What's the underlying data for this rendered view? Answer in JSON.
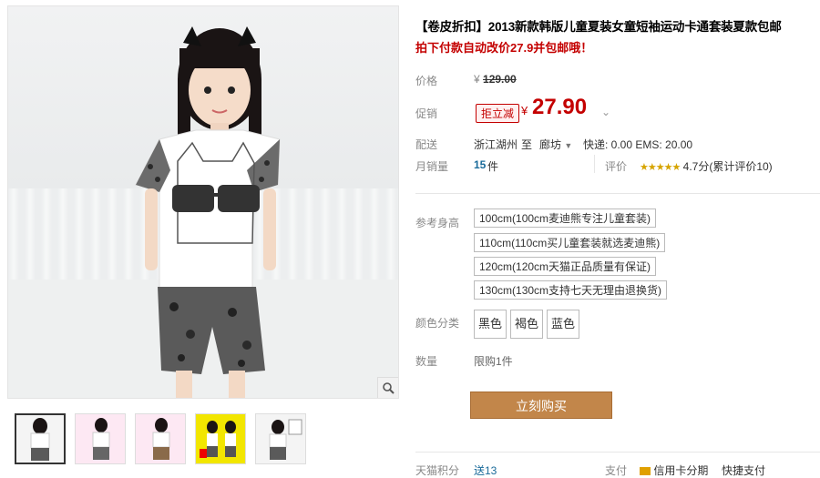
{
  "product": {
    "title": "【卷皮折扣】2013新款韩版儿童夏装女童短袖运动卡通套装夏款包邮",
    "promo_text": "拍下付款自动改价27.9并包邮哦！"
  },
  "pricing": {
    "orig_label": "价格",
    "orig_currency": "¥",
    "orig_price": "129.00",
    "promo_label": "促销",
    "promo_tag": "拒立减",
    "promo_currency": "¥",
    "promo_price": "27.90"
  },
  "shipping": {
    "label": "配送",
    "from": "浙江湖州",
    "to_word": "至",
    "dest": "廊坊",
    "fee": "快递: 0.00 EMS: 20.00"
  },
  "sales": {
    "label": "月销量",
    "count": "15",
    "unit": "件",
    "rating_label": "评价",
    "stars": "★★★★★",
    "rating": "4.7分(累计评价10)"
  },
  "size": {
    "label": "参考身高",
    "options": [
      "100cm(100cm麦迪熊专注儿童套装)",
      "110cm(110cm买儿童套装就选麦迪熊)",
      "120cm(120cm天猫正品质量有保证)",
      "130cm(130cm支持七天无理由退换货)"
    ]
  },
  "color": {
    "label": "颜色分类",
    "options": [
      "黑色",
      "褐色",
      "蓝色"
    ]
  },
  "quantity": {
    "label": "数量",
    "value": "限购1件"
  },
  "buy_button": "立刻购买",
  "footer": {
    "points_label": "天猫积分",
    "points_value": "送13",
    "pay_label": "支付",
    "pay_option1": "信用卡分期",
    "pay_option2": "快捷支付"
  },
  "colors": {
    "accent_red": "#c40000",
    "buy_button": "#c2864a"
  }
}
